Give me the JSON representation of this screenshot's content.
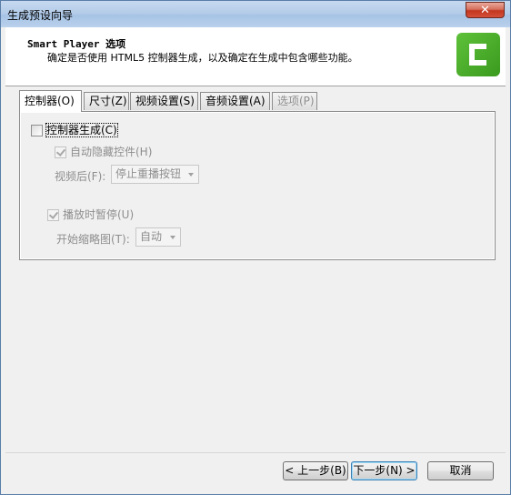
{
  "window": {
    "title": "生成预设向导",
    "close_label": "✕"
  },
  "header": {
    "title": "Smart Player 选项",
    "description": "确定是否使用 HTML5 控制器生成，以及确定在生成中包含哪些功能。",
    "logo_icon": "camtasia-c-icon",
    "logo_color": "#4caf2a"
  },
  "tabs": [
    {
      "label": "控制器(O)",
      "active": true
    },
    {
      "label": "尺寸(Z)"
    },
    {
      "label": "视频设置(S)"
    },
    {
      "label": "音频设置(A)"
    },
    {
      "label": "选项(P)",
      "disabled": true
    }
  ],
  "controller": {
    "generate_label": "控制器生成(C)",
    "generate_checked": false,
    "autohide_label": "自动隐藏控件(H)",
    "autohide_checked": true,
    "after_video_label": "视频后(F):",
    "after_video_value": "停止重播按钮",
    "pause_label": "播放时暂停(U)",
    "pause_checked": true,
    "start_thumb_label": "开始缩略图(T):",
    "start_thumb_value": "自动"
  },
  "footer": {
    "back_label": "< 上一步(B)",
    "next_label": "下一步(N) >",
    "cancel_label": "取消"
  }
}
